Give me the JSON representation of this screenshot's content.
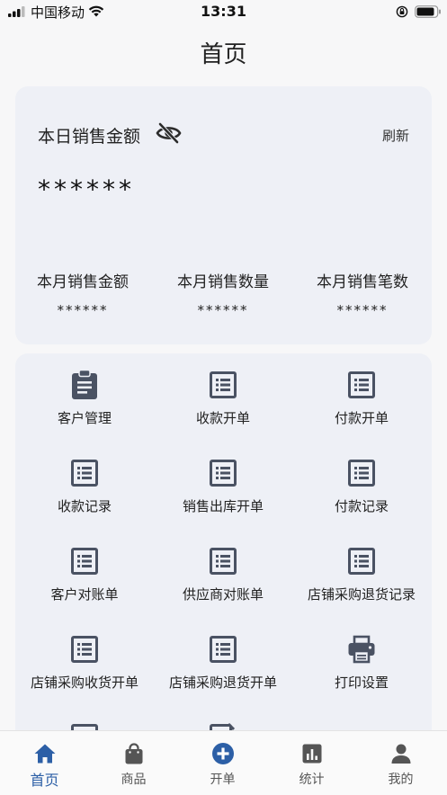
{
  "status_bar": {
    "carrier": "中国移动",
    "time": "13:31"
  },
  "page": {
    "title": "首页"
  },
  "sales": {
    "today_label": "本日销售金额",
    "refresh_label": "刷新",
    "today_value": "******",
    "stats": [
      {
        "label": "本月销售金额",
        "value": "******"
      },
      {
        "label": "本月销售数量",
        "value": "******"
      },
      {
        "label": "本月销售笔数",
        "value": "******"
      }
    ]
  },
  "menu": {
    "items": [
      {
        "label": "客户管理",
        "icon": "clipboard-icon"
      },
      {
        "label": "收款开单",
        "icon": "list-icon"
      },
      {
        "label": "付款开单",
        "icon": "list-icon"
      },
      {
        "label": "收款记录",
        "icon": "list-icon"
      },
      {
        "label": "销售出库开单",
        "icon": "list-icon"
      },
      {
        "label": "付款记录",
        "icon": "list-icon"
      },
      {
        "label": "客户对账单",
        "icon": "list-icon"
      },
      {
        "label": "供应商对账单",
        "icon": "list-icon"
      },
      {
        "label": "店铺采购退货记录",
        "icon": "list-icon"
      },
      {
        "label": "店铺采购收货开单",
        "icon": "list-icon"
      },
      {
        "label": "店铺采购退货开单",
        "icon": "list-icon"
      },
      {
        "label": "打印设置",
        "icon": "printer-icon"
      }
    ]
  },
  "tab_bar": {
    "tabs": [
      {
        "label": "首页",
        "icon": "home-icon",
        "active": true
      },
      {
        "label": "商品",
        "icon": "shopping-bag-icon",
        "active": false
      },
      {
        "label": "开单",
        "icon": "plus-circle-icon",
        "active": false
      },
      {
        "label": "统计",
        "icon": "bar-chart-icon",
        "active": false
      },
      {
        "label": "我的",
        "icon": "person-icon",
        "active": false
      }
    ]
  },
  "colors": {
    "accent": "#2c5fa6",
    "icon": "#4a5263",
    "card_bg": "#eef0f6"
  }
}
